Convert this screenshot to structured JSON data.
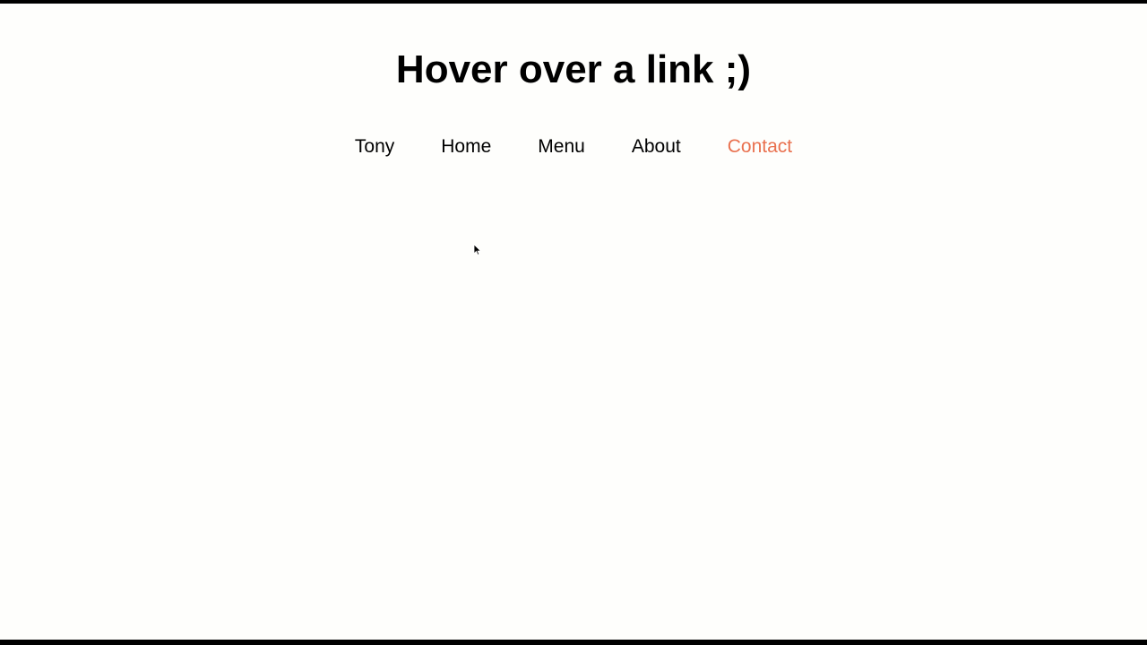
{
  "page": {
    "title": "Hover over a link ;)"
  },
  "nav": {
    "links": [
      {
        "label": "Tony"
      },
      {
        "label": "Home"
      },
      {
        "label": "Menu"
      },
      {
        "label": "About"
      },
      {
        "label": "Contact",
        "state": "hovered"
      }
    ]
  },
  "colors": {
    "background": "#fefefc",
    "text": "#000000",
    "hover_accent": "#e9714f",
    "frame": "#000000"
  },
  "icons": {
    "cursor": "mouse-pointer-icon"
  }
}
